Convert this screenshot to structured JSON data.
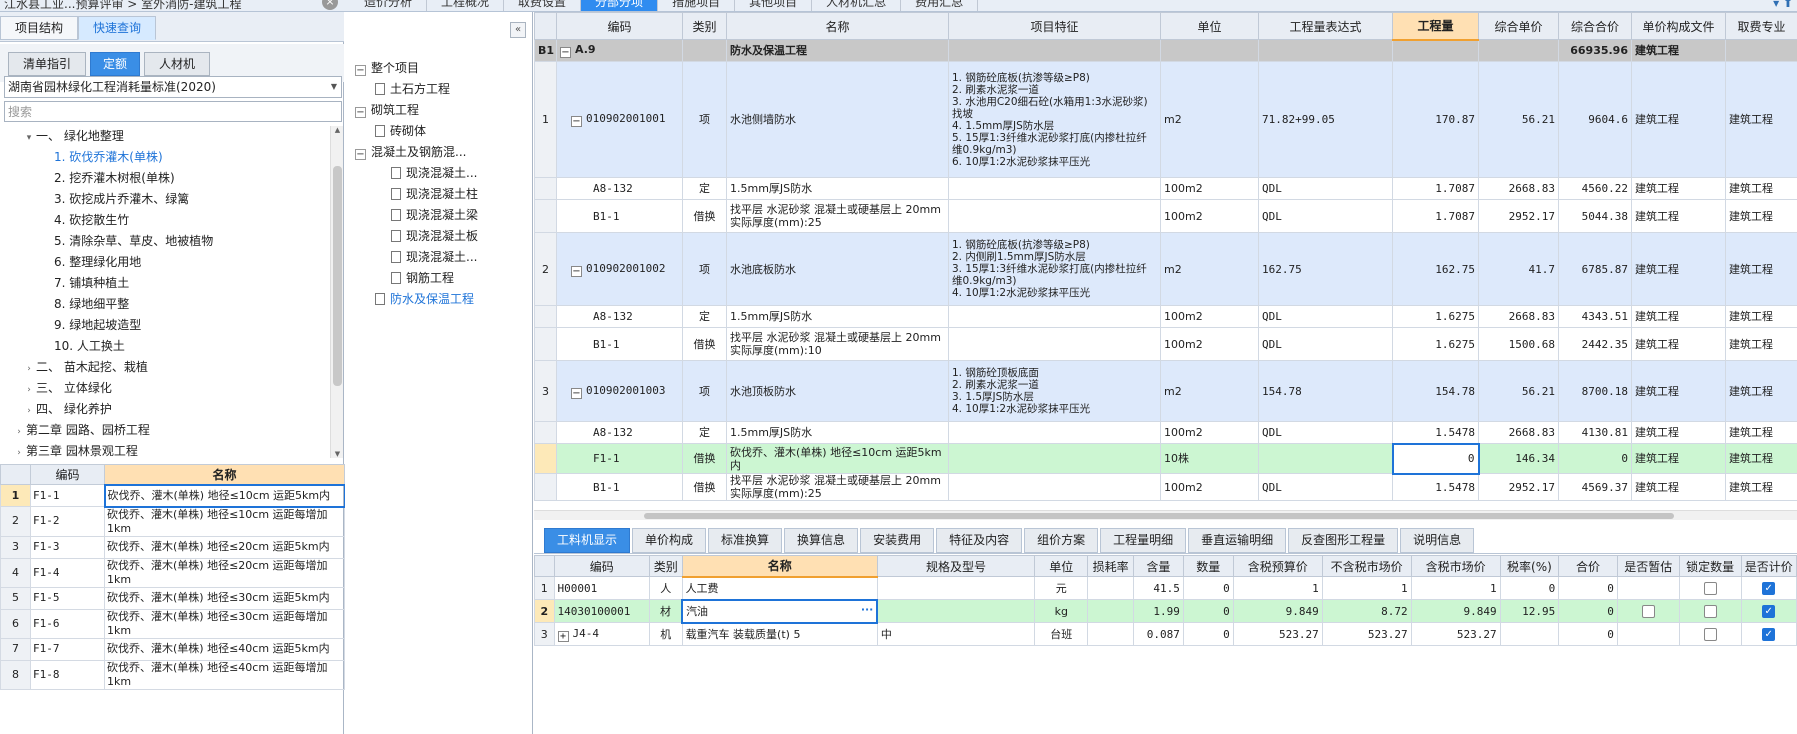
{
  "topbar": {
    "breadcrumb": "江水县工业...预算评审 > 室外消防-建筑工程",
    "close": "×",
    "tabs": [
      "造价分析",
      "工程概况",
      "取费设置",
      "分部分项",
      "措施项目",
      "其他项目",
      "人材机汇总",
      "费用汇总"
    ],
    "active_tab": 3,
    "icons": "▾ ⬆"
  },
  "left": {
    "tabs": [
      "项目结构",
      "快速查询"
    ],
    "subtabs": [
      "清单指引",
      "定额",
      "人材机"
    ],
    "standard": "湖南省园林绿化工程消耗量标准(2020)",
    "search_placeholder": "搜索",
    "tree": [
      {
        "t": "▾",
        "label": "一、 绿化地整理"
      },
      {
        "t": "",
        "label": "1.  砍伐乔灌木(单株)"
      },
      {
        "t": "",
        "label": "2.  挖乔灌木树根(单株)"
      },
      {
        "t": "",
        "label": "3.  砍挖成片乔灌木、绿篱"
      },
      {
        "t": "",
        "label": "4.  砍挖散生竹"
      },
      {
        "t": "",
        "label": "5.  清除杂草、草皮、地被植物"
      },
      {
        "t": "",
        "label": "6.  整理绿化用地"
      },
      {
        "t": "",
        "label": "7.  铺填种植土"
      },
      {
        "t": "",
        "label": "8.  绿地细平整"
      },
      {
        "t": "",
        "label": "9.  绿地起坡造型"
      },
      {
        "t": "",
        "label": "10.  人工换土"
      },
      {
        "t": "›",
        "label": "二、 苗木起挖、栽植"
      },
      {
        "t": "›",
        "label": "三、 立体绿化"
      },
      {
        "t": "›",
        "label": "四、 绿化养护"
      },
      {
        "t": "›",
        "label": "第二章  园路、园桥工程"
      },
      {
        "t": "›",
        "label": "第三章  园林景观工程"
      }
    ],
    "table": {
      "headers": [
        "编码",
        "名称"
      ],
      "rows": [
        {
          "n": "1",
          "code": "F1-1",
          "name": "砍伐乔、灌木(单株) 地径≤10cm 运距5km内"
        },
        {
          "n": "2",
          "code": "F1-2",
          "name": "砍伐乔、灌木(单株) 地径≤10cm 运距每增加1km"
        },
        {
          "n": "3",
          "code": "F1-3",
          "name": "砍伐乔、灌木(单株) 地径≤20cm 运距5km内"
        },
        {
          "n": "4",
          "code": "F1-4",
          "name": "砍伐乔、灌木(单株) 地径≤20cm 运距每增加1km"
        },
        {
          "n": "5",
          "code": "F1-5",
          "name": "砍伐乔、灌木(单株) 地径≤30cm 运距5km内"
        },
        {
          "n": "6",
          "code": "F1-6",
          "name": "砍伐乔、灌木(单株) 地径≤30cm 运距每增加1km"
        },
        {
          "n": "7",
          "code": "F1-7",
          "name": "砍伐乔、灌木(单株) 地径≤40cm 运距5km内"
        },
        {
          "n": "8",
          "code": "F1-8",
          "name": "砍伐乔、灌木(单株) 地径≤40cm 运距每增加1km"
        }
      ]
    }
  },
  "mid": {
    "collapse": "«",
    "tree": [
      {
        "box": "−",
        "label": "整个项目"
      },
      {
        "box": "",
        "label": "土石方工程"
      },
      {
        "box": "−",
        "label": "砌筑工程"
      },
      {
        "box": "",
        "label": "砖砌体"
      },
      {
        "box": "−",
        "label": "混凝土及钢筋混..."
      },
      {
        "box": "",
        "label": "现浇混凝土..."
      },
      {
        "box": "",
        "label": "现浇混凝土柱"
      },
      {
        "box": "",
        "label": "现浇混凝土梁"
      },
      {
        "box": "",
        "label": "现浇混凝土板"
      },
      {
        "box": "",
        "label": "现浇混凝土..."
      },
      {
        "box": "",
        "label": "钢筋工程"
      },
      {
        "box": "",
        "label": "防水及保温工程"
      }
    ]
  },
  "grid": {
    "headers": [
      "编码",
      "类别",
      "名称",
      "项目特征",
      "单位",
      "工程量表达式",
      "工程量",
      "综合单价",
      "综合合价",
      "单价构成文件",
      "取费专业"
    ],
    "section": {
      "rh": "B1",
      "box": "−",
      "code": "A.9",
      "name": "防水及保温工程",
      "total": "66935.96",
      "file": "建筑工程"
    },
    "rows": [
      {
        "kind": "item",
        "rh": "1",
        "code": "010902001001",
        "cat": "项",
        "name": "水池侧墙防水",
        "feature": "1. 钢筋砼底板(抗渗等级≥P8)\n2. 刷素水泥浆一道\n3. 水池用C20细石砼(水箱用1:3水泥砂浆)找坡\n4. 1.5mm厚JS防水层\n5. 15厚1:3纤维水泥砂浆打底(内掺杜拉纤维0.9kg/m3)\n6. 10厚1:2水泥砂浆抹平压光",
        "unit": "m2",
        "expr": "71.82+99.05",
        "qty": "170.87",
        "price": "56.21",
        "total": "9604.6",
        "file": "建筑工程",
        "spec": "建筑工程"
      },
      {
        "kind": "sub",
        "rh": "",
        "code": "A8-132",
        "cat": "定",
        "name": "1.5mm厚JS防水",
        "feature": "",
        "unit": "100m2",
        "expr": "QDL",
        "qty": "1.7087",
        "price": "2668.83",
        "total": "4560.22",
        "file": "建筑工程",
        "spec": "建筑工程"
      },
      {
        "kind": "sub",
        "rh": "",
        "code": "B1-1",
        "cat": "借换",
        "name": "找平层 水泥砂浆 混凝土或硬基层上 20mm  实际厚度(mm):25",
        "feature": "",
        "unit": "100m2",
        "expr": "QDL",
        "qty": "1.7087",
        "price": "2952.17",
        "total": "5044.38",
        "file": "建筑工程",
        "spec": "建筑工程"
      },
      {
        "kind": "item",
        "rh": "2",
        "code": "010902001002",
        "cat": "项",
        "name": "水池底板防水",
        "feature": "1. 钢筋砼底板(抗渗等级≥P8)\n2. 内侧刷1.5mm厚JS防水层\n3. 15厚1:3纤维水泥砂浆打底(内掺杜拉纤维0.9kg/m3)\n4.  10厚1:2水泥砂浆抹平压光",
        "unit": "m2",
        "expr": "162.75",
        "qty": "162.75",
        "price": "41.7",
        "total": "6785.87",
        "file": "建筑工程",
        "spec": "建筑工程"
      },
      {
        "kind": "sub",
        "rh": "",
        "code": "A8-132",
        "cat": "定",
        "name": "1.5mm厚JS防水",
        "feature": "",
        "unit": "100m2",
        "expr": "QDL",
        "qty": "1.6275",
        "price": "2668.83",
        "total": "4343.51",
        "file": "建筑工程",
        "spec": "建筑工程"
      },
      {
        "kind": "sub",
        "rh": "",
        "code": "B1-1",
        "cat": "借换",
        "name": "找平层 水泥砂浆 混凝土或硬基层上 20mm    实际厚度(mm):10",
        "feature": "",
        "unit": "100m2",
        "expr": "QDL",
        "qty": "1.6275",
        "price": "1500.68",
        "total": "2442.35",
        "file": "建筑工程",
        "spec": "建筑工程"
      },
      {
        "kind": "item",
        "rh": "3",
        "code": "010902001003",
        "cat": "项",
        "name": "水池顶板防水",
        "feature": "1. 钢筋砼顶板底面\n2. 刷素水泥浆一道\n3. 1.5厚JS防水层\n4. 10厚1:2水泥砂浆抹平压光",
        "unit": "m2",
        "expr": "154.78",
        "qty": "154.78",
        "price": "56.21",
        "total": "8700.18",
        "file": "建筑工程",
        "spec": "建筑工程"
      },
      {
        "kind": "sub",
        "rh": "",
        "code": "A8-132",
        "cat": "定",
        "name": "1.5mm厚JS防水",
        "feature": "",
        "unit": "100m2",
        "expr": "QDL",
        "qty": "1.5478",
        "price": "2668.83",
        "total": "4130.81",
        "file": "建筑工程",
        "spec": "建筑工程"
      },
      {
        "kind": "sel",
        "rh": "",
        "code": "F1-1",
        "cat": "借换",
        "name": "砍伐乔、灌木(单株) 地径≤10cm 运距5km内",
        "feature": "",
        "unit": "10株",
        "expr": "",
        "qty": "0",
        "price": "146.34",
        "total": "0",
        "file": "建筑工程",
        "spec": "建筑工程"
      },
      {
        "kind": "sub",
        "rh": "",
        "code": "B1-1",
        "cat": "借换",
        "name": "找平层 水泥砂浆 混凝土或硬基层上 20mm  实际厚度(mm):25",
        "feature": "",
        "unit": "100m2",
        "expr": "QDL",
        "qty": "1.5478",
        "price": "2952.17",
        "total": "4569.37",
        "file": "建筑工程",
        "spec": "建筑工程"
      }
    ]
  },
  "detail": {
    "tabs": [
      "工料机显示",
      "单价构成",
      "标准换算",
      "换算信息",
      "安装费用",
      "特征及内容",
      "组价方案",
      "工程量明细",
      "垂直运输明细",
      "反查图形工程量",
      "说明信息"
    ],
    "headers": [
      "编码",
      "类别",
      "名称",
      "规格及型号",
      "单位",
      "损耗率",
      "含量",
      "数量",
      "含税预算价",
      "不含税市场价",
      "含税市场价",
      "税率(%)",
      "合价",
      "是否暂估",
      "锁定数量",
      "是否计价"
    ],
    "rows": [
      {
        "rh": "1",
        "code": "H00001",
        "cat": "人",
        "name": "人工费",
        "spec": "",
        "unit": "元",
        "loss": "",
        "content": "41.5",
        "qty": "0",
        "budget": "1",
        "market": "1",
        "taxmarket": "1",
        "tax": "0",
        "total": "0"
      },
      {
        "rh": "2",
        "code": "14030100001",
        "cat": "材",
        "name": "汽油",
        "spec": "",
        "unit": "kg",
        "loss": "",
        "content": "1.99",
        "qty": "0",
        "budget": "9.849",
        "market": "8.72",
        "taxmarket": "9.849",
        "tax": "12.95",
        "total": "0"
      },
      {
        "rh": "3",
        "code": "J4-4",
        "cat": "机",
        "name": "载重汽车 装载质量(t) 5",
        "spec": "中",
        "unit": "台班",
        "loss": "",
        "content": "0.087",
        "qty": "0",
        "budget": "523.27",
        "market": "523.27",
        "taxmarket": "523.27",
        "tax": "",
        "total": "0"
      }
    ]
  }
}
